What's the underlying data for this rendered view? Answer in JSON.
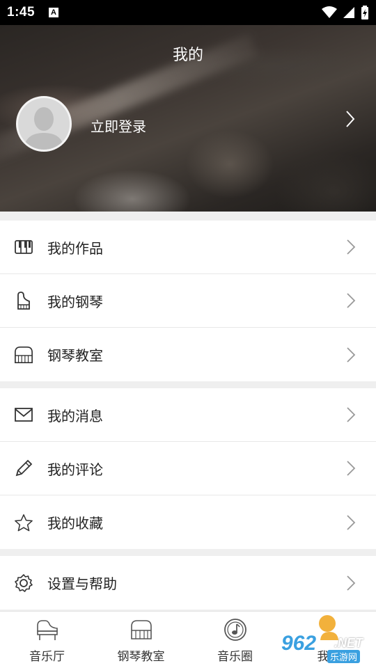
{
  "status_bar": {
    "time": "1:45",
    "badge": "A"
  },
  "header": {
    "title": "我的",
    "login_label": "立即登录"
  },
  "menu_groups": [
    [
      {
        "icon": "piano-keys-icon",
        "label": "我的作品"
      },
      {
        "icon": "piano-icon",
        "label": "我的钢琴"
      },
      {
        "icon": "grand-piano-icon",
        "label": "钢琴教室"
      }
    ],
    [
      {
        "icon": "mail-icon",
        "label": "我的消息"
      },
      {
        "icon": "pencil-icon",
        "label": "我的评论"
      },
      {
        "icon": "star-icon",
        "label": "我的收藏"
      }
    ],
    [
      {
        "icon": "gear-icon",
        "label": "设置与帮助"
      }
    ]
  ],
  "tabs": [
    {
      "icon": "grand-piano-icon",
      "label": "音乐厅"
    },
    {
      "icon": "piano-classroom-icon",
      "label": "钢琴教室"
    },
    {
      "icon": "music-circle-icon",
      "label": "音乐圈"
    },
    {
      "icon": "person-icon",
      "label": "我的"
    }
  ],
  "watermark": {
    "number": "962",
    "suffix": ".NET",
    "site": "乐游网"
  },
  "colors": {
    "watermark_blue": "#3aa0e0",
    "watermark_orange": "#f2b13c"
  }
}
